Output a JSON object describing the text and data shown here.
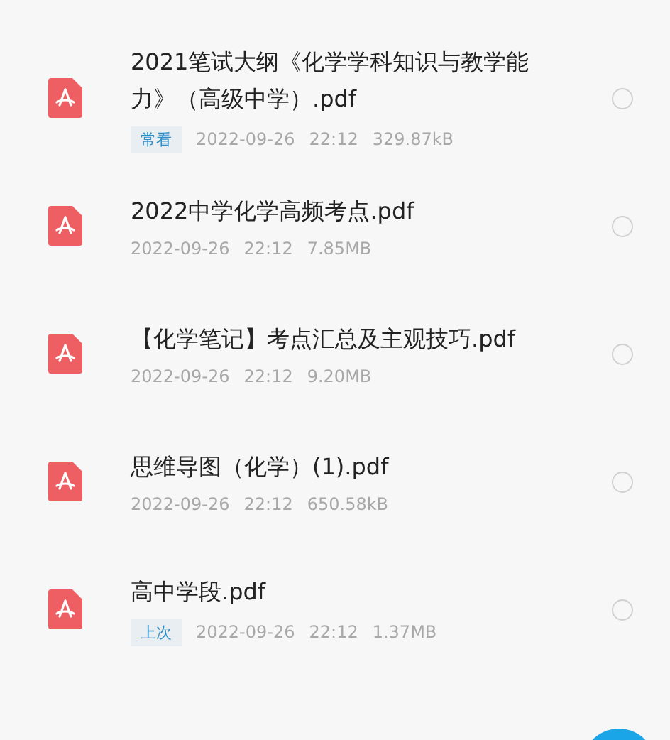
{
  "files": [
    {
      "name": "2021笔试大纲《化学学科知识与教学能力》（高级中学）.pdf",
      "tag": "常看",
      "date": "2022-09-26",
      "time": "22:12",
      "size": "329.87kB",
      "selected": false
    },
    {
      "name": "2022中学化学高频考点.pdf",
      "date": "2022-09-26",
      "time": "22:12",
      "size": "7.85MB",
      "selected": false
    },
    {
      "name": "【化学笔记】考点汇总及主观技巧.pdf",
      "date": "2022-09-26",
      "time": "22:12",
      "size": "9.20MB",
      "selected": false
    },
    {
      "name": "思维导图（化学）(1).pdf",
      "date": "2022-09-26",
      "time": "22:12",
      "size": "650.58kB",
      "selected": false
    },
    {
      "name": "高中学段.pdf",
      "tag": "上次",
      "date": "2022-09-26",
      "time": "22:12",
      "size": "1.37MB",
      "selected": false
    }
  ]
}
